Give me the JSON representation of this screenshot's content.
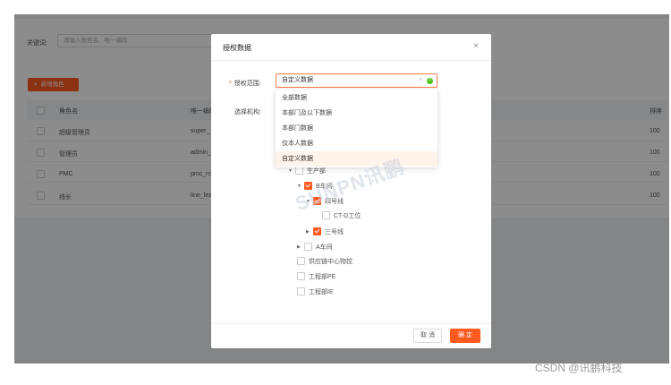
{
  "search": {
    "label": "关键词:",
    "placeholder": "请输入角色名、唯一编码"
  },
  "toolbar": {
    "add_label": "新增角色",
    "add_icon": "plus-icon"
  },
  "table": {
    "headers": [
      "角色名",
      "唯一编码",
      "排序"
    ],
    "rows": [
      {
        "name": "超级管理员",
        "code": "super_",
        "order": "100"
      },
      {
        "name": "管理员",
        "code": "admin_",
        "order": "100"
      },
      {
        "name": "PMC",
        "code": "pmc_rc",
        "order": "100"
      },
      {
        "name": "线长",
        "code": "line_lea",
        "order": "100"
      }
    ]
  },
  "modal": {
    "title": "授权数据",
    "close": "×",
    "scope_label": "授权范围:",
    "scope_value": "自定义数据",
    "org_label": "选择机构:",
    "options": [
      "全部数据",
      "本部门及以下数据",
      "本部门数据",
      "仅本人数据",
      "自定义数据"
    ],
    "selected_option": "自定义数据",
    "tree": [
      {
        "label": "生产部",
        "level": 1,
        "expanded": true,
        "checked": false
      },
      {
        "label": "B车间",
        "level": 2,
        "expanded": true,
        "checked": true
      },
      {
        "label": "四号线",
        "level": 3,
        "expanded": true,
        "checked": true
      },
      {
        "label": "CT-D工位",
        "level": 4,
        "expanded": null,
        "checked": false
      },
      {
        "label": "三号线",
        "level": 3,
        "expanded": false,
        "checked": true
      },
      {
        "label": "A车间",
        "level": 2,
        "expanded": false,
        "checked": false
      },
      {
        "label": "供应链中心物控",
        "level": 1,
        "expanded": null,
        "checked": false
      },
      {
        "label": "工程部PE",
        "level": 1,
        "expanded": null,
        "checked": false
      },
      {
        "label": "工程部IE",
        "level": 1,
        "expanded": null,
        "checked": false
      }
    ],
    "cancel_label": "取 消",
    "ok_label": "确 定"
  },
  "watermark": "SUNPN讯鹏",
  "credit": "CSDN @讯鹏科技",
  "colors": {
    "accent": "#ff5a1f",
    "success": "#52c41a",
    "required": "#ff4d4f"
  }
}
